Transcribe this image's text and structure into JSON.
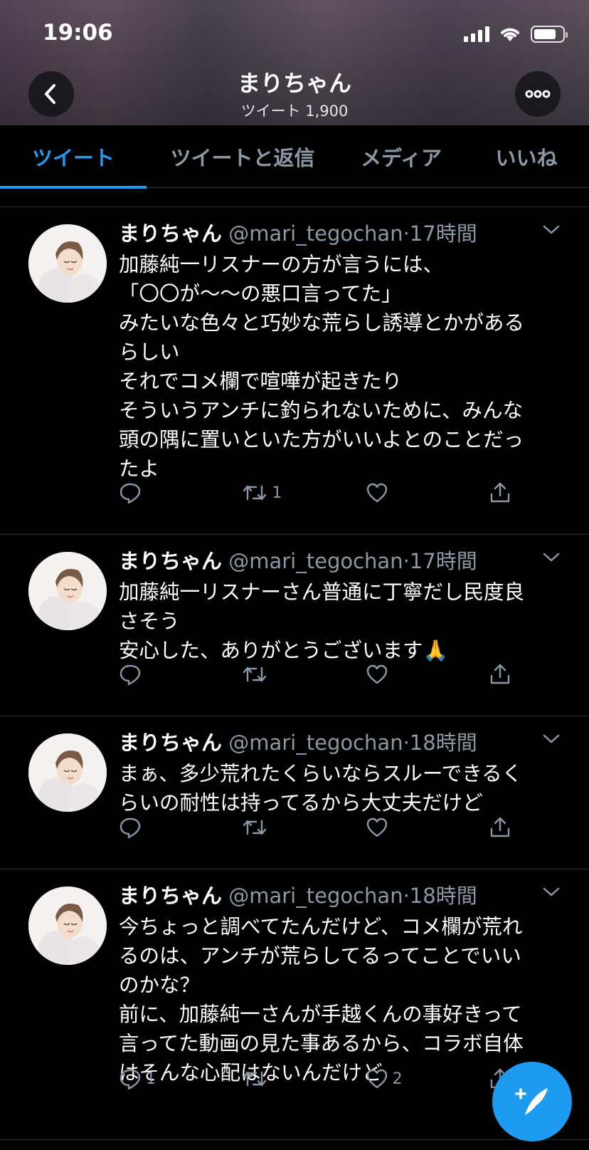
{
  "status_bar": {
    "time": "19:06"
  },
  "header": {
    "title": "まりちゃん",
    "subtitle": "ツイート 1,900"
  },
  "tabs": [
    {
      "label": "ツイート",
      "active": true
    },
    {
      "label": "ツイートと返信",
      "active": false
    },
    {
      "label": "メディア",
      "active": false
    },
    {
      "label": "いいね",
      "active": false
    }
  ],
  "tweets": [
    {
      "name": "まりちゃん",
      "handle": "@mari_tegochan",
      "time": "·17時間",
      "text": "加藤純一リスナーの方が言うには、\n「〇〇が〜〜の悪口言ってた」\nみたいな色々と巧妙な荒らし誘導とかがある\nらしい\nそれでコメ欄で喧嘩が起きたり\nそういうアンチに釣られないために、みんな\n頭の隅に置いといた方がいいよとのことだっ\nたよ",
      "replies": "",
      "retweets": "1",
      "likes": ""
    },
    {
      "name": "まりちゃん",
      "handle": "@mari_tegochan",
      "time": "·17時間",
      "text": "加藤純一リスナーさん普通に丁寧だし民度良\nさそう\n安心した、ありがとうございます🙏",
      "replies": "",
      "retweets": "",
      "likes": ""
    },
    {
      "name": "まりちゃん",
      "handle": "@mari_tegochan",
      "time": "·18時間",
      "text": "まぁ、多少荒れたくらいならスルーできるく\nらいの耐性は持ってるから大丈夫だけど",
      "replies": "",
      "retweets": "",
      "likes": ""
    },
    {
      "name": "まりちゃん",
      "handle": "@mari_tegochan",
      "time": "·18時間",
      "text": "今ちょっと調べてたんだけど、コメ欄が荒れ\nるのは、アンチが荒らしてるってことでいい\nのかな？\n前に、加藤純一さんが手越くんの事好きって\n言ってた動画の見た事あるから、コラボ自体\nはそんな心配はないんだけど",
      "replies": "1",
      "retweets": "",
      "likes": "2"
    }
  ],
  "colors": {
    "accent": "#1d9bf0",
    "muted": "#8b98a5",
    "divider": "#2f3336"
  },
  "icons": [
    "back-arrow-icon",
    "more-icon",
    "chevron-down-icon",
    "reply-icon",
    "retweet-icon",
    "like-icon",
    "share-icon",
    "compose-icon"
  ]
}
